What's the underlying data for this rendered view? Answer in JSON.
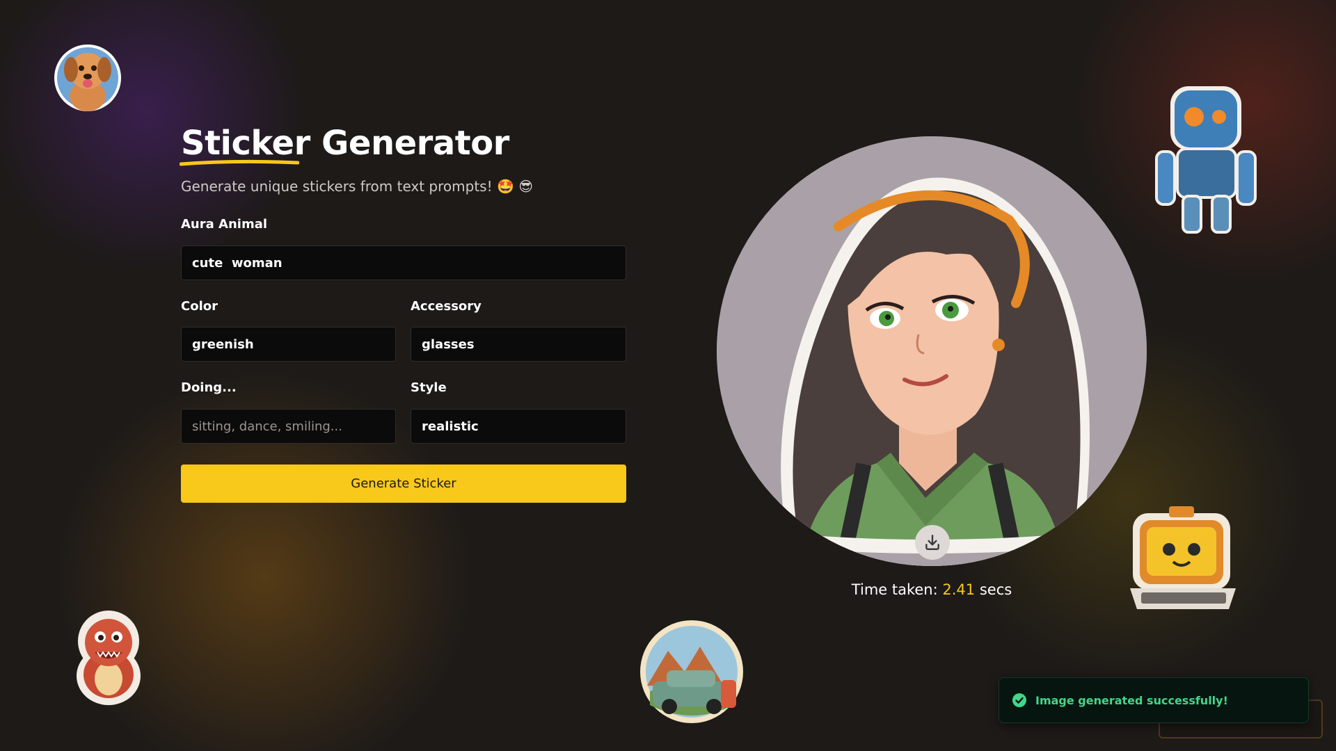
{
  "header": {
    "title_word1": "Sticker",
    "title_word2": "Generator",
    "subtitle": "Generate unique stickers from text prompts! 🤩 😎"
  },
  "form": {
    "aura_label": "Aura Animal",
    "aura_value": "cute  woman",
    "color_label": "Color",
    "color_value": "greenish",
    "accessory_label": "Accessory",
    "accessory_value": "glasses",
    "doing_label": "Doing...",
    "doing_placeholder": "sitting, dance, smiling...",
    "style_label": "Style",
    "style_value": "realistic",
    "generate_label": "Generate Sticker"
  },
  "result": {
    "time_prefix": "Time taken:",
    "time_value": "2.41",
    "time_suffix": "secs"
  },
  "toast": {
    "message": "Image generated successfully!"
  },
  "colors": {
    "accent": "#f8c81b",
    "background": "#1d1a18",
    "success": "#43d68a"
  },
  "icons": {
    "download": "download-icon",
    "success": "check-circle-icon"
  }
}
